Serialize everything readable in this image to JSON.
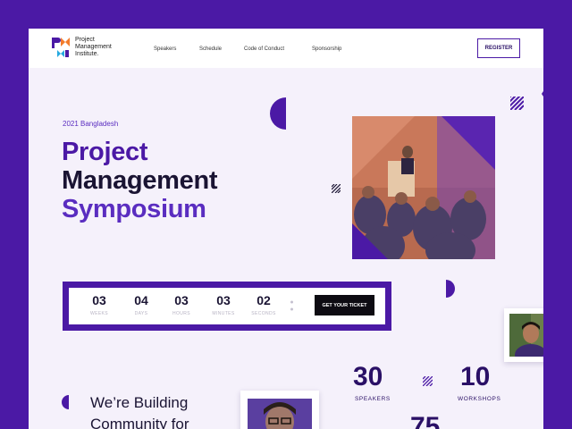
{
  "logo": {
    "line1": "Project",
    "line2": "Management",
    "line3": "Institute."
  },
  "nav": {
    "links": [
      "Speakers",
      "Schedule",
      "Code of Conduct",
      "Sponsorship"
    ],
    "register_label": "REGISTER"
  },
  "hero": {
    "eyebrow": "2021 Bangladesh",
    "title_line1": "Project",
    "title_line2": "Management",
    "title_line3": "Symposium"
  },
  "countdown": {
    "units": [
      {
        "value": "03",
        "label": "WEEKS"
      },
      {
        "value": "04",
        "label": "DAYS"
      },
      {
        "value": "03",
        "label": "HOURS"
      },
      {
        "value": "03",
        "label": "MINUTES"
      },
      {
        "value": "02",
        "label": "SECONDS"
      }
    ],
    "ticket_label": "GET YOUR TICKET"
  },
  "about": {
    "line1": "We’re Building",
    "line2": "Community for"
  },
  "stats": [
    {
      "value": "30",
      "label": "SPEAKERS"
    },
    {
      "value": "10",
      "label": "WORKSHOPS"
    },
    {
      "value": "75",
      "label": ""
    }
  ],
  "colors": {
    "brand": "#4b19a5",
    "accent": "#5a2dc0",
    "dark": "#1a1433",
    "background": "#f5f1fb"
  }
}
